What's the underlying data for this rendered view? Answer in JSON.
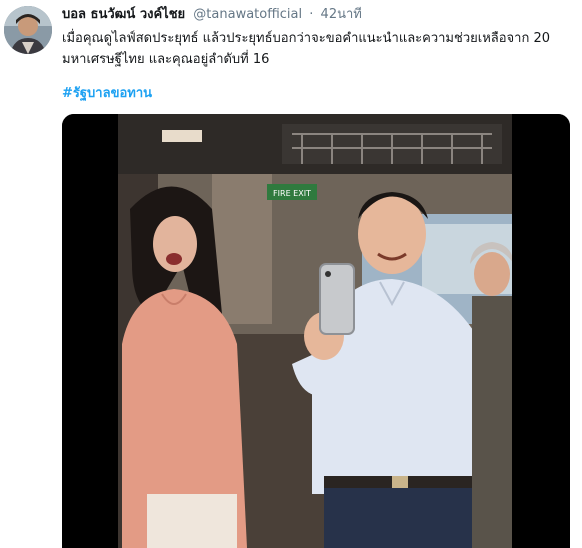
{
  "tweet": {
    "display_name": "บอล ธนวัฒน์ วงค์ไชย",
    "handle": "@tanawatofficial",
    "separator": "·",
    "time": "42นาที",
    "text": "เมื่อคุณดูไลฟ์สดประยุทธ์ แล้วประยุทธ์บอกว่าจะขอคำแนะนำและความช่วยเหลือจาก 20 มหาเศรษฐีไทย และคุณอยู่ลำดับที่ 16",
    "hashtag": "#รัฐบาลขอทาน"
  },
  "media": {
    "sign_text": "FIRE EXIT"
  },
  "colors": {
    "link": "#1da1f2",
    "secondary_text": "#657786",
    "video_background": "#000000"
  },
  "icons": [
    "avatar-photo",
    "video-frame"
  ]
}
